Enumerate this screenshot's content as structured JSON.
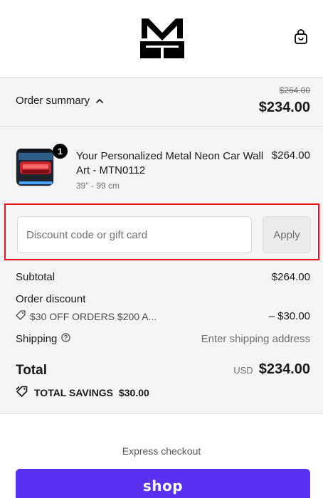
{
  "header": {
    "logo_text": "MT",
    "cart_icon": "shopping-bag-icon"
  },
  "summary": {
    "toggle_label": "Order summary",
    "toggle_icon": "chevron-up-icon",
    "original_total": "$264.00",
    "total": "$234.00"
  },
  "cart": {
    "items": [
      {
        "title": "Your Personalized Metal Neon Car Wall Art - MTN0112",
        "variant": "39\" - 99 cm",
        "price": "$264.00",
        "quantity": "1"
      }
    ]
  },
  "discount": {
    "placeholder": "Discount code or gift card",
    "value": "",
    "apply_label": "Apply"
  },
  "totals": {
    "subtotal_label": "Subtotal",
    "subtotal_value": "$264.00",
    "order_discount_label": "Order discount",
    "discount_code": "$30 OFF ORDERS $200 A...",
    "discount_value": "– $30.00",
    "shipping_label": "Shipping",
    "shipping_value": "Enter shipping address",
    "total_label": "Total",
    "currency": "USD",
    "total_value": "$234.00",
    "savings_label": "TOTAL SAVINGS",
    "savings_value": "$30.00"
  },
  "checkout": {
    "express_label": "Express checkout",
    "shop_pay_label": "shop"
  },
  "colors": {
    "highlight_border": "#e8121b",
    "shop_pay": "#5a31f4",
    "panel_bg": "#f5f5f5"
  }
}
